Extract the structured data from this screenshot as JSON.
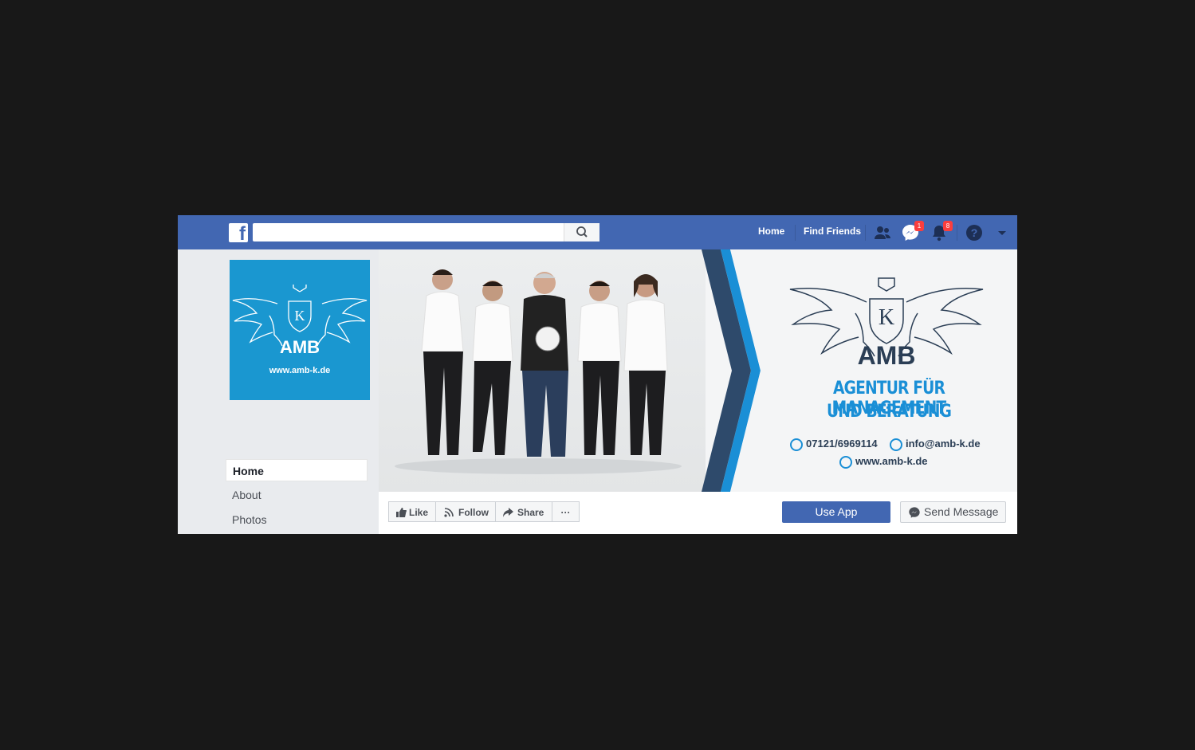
{
  "topbar": {
    "logo": "f",
    "search_placeholder": "",
    "nav": {
      "home": "Home",
      "find_friends": "Find Friends"
    },
    "badges": {
      "messenger": "1",
      "notifications": "8"
    },
    "colors": {
      "bar": "#4267b2"
    }
  },
  "sidebar": {
    "profile": {
      "brand": "AMB",
      "url": "www.amb-k.de",
      "monogram": "K"
    },
    "items": [
      {
        "label": "Home",
        "active": true
      },
      {
        "label": "About",
        "active": false
      },
      {
        "label": "Photos",
        "active": false
      }
    ]
  },
  "cover": {
    "monogram": "K",
    "brand": "AMB",
    "headline_line1": "AGENTUR FÜR MANAGEMENT",
    "headline_line2": "UND BERATUNG",
    "phone": "07121/6969114",
    "email": "info@amb-k.de",
    "website": "www.amb-k.de",
    "accent": "#1a8fd6"
  },
  "actions": {
    "like": "Like",
    "follow": "Follow",
    "share": "Share",
    "more": "···",
    "use_app": "Use App",
    "send_message": "Send Message"
  }
}
